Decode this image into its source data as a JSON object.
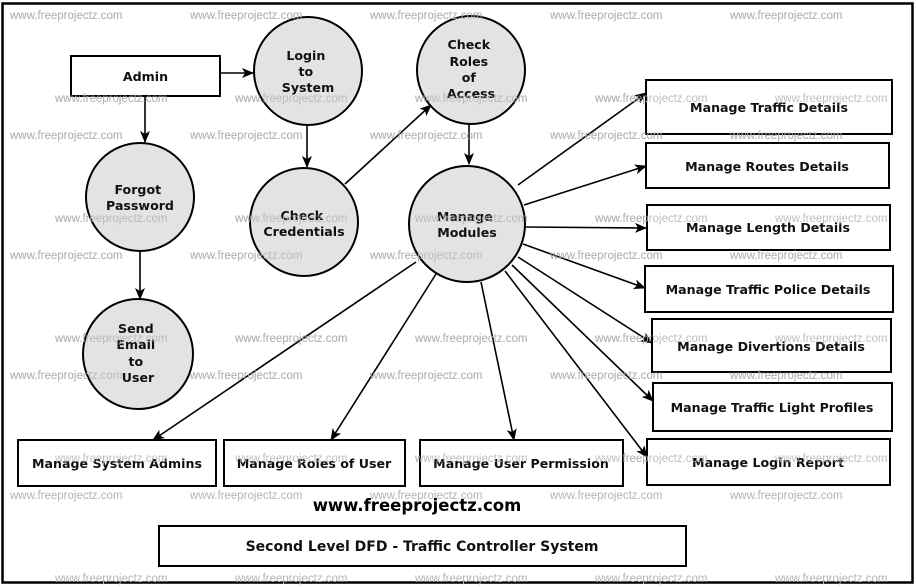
{
  "diagram": {
    "title": "Second Level DFD - Traffic Controller System",
    "website": "www.freeprojectz.com",
    "watermark_text": "www.freeprojectz.com",
    "colors": {
      "process_fill": "#e3e3e3",
      "stroke": "#000000",
      "watermark": "#b4b4b4",
      "background": "#ffffff"
    },
    "entities": [
      {
        "id": "admin",
        "label": "Admin"
      }
    ],
    "processes": [
      {
        "id": "login",
        "lines": [
          "Login",
          "to",
          "System"
        ]
      },
      {
        "id": "check_roles",
        "lines": [
          "Check",
          "Roles",
          "of",
          "Access"
        ]
      },
      {
        "id": "forgot",
        "lines": [
          "Forgot",
          "Password"
        ]
      },
      {
        "id": "check_cred",
        "lines": [
          "Check",
          "Credentials"
        ]
      },
      {
        "id": "manage_modules",
        "lines": [
          "Manage",
          "Modules"
        ]
      },
      {
        "id": "send_email",
        "lines": [
          "Send",
          "Email",
          "to",
          "User"
        ]
      }
    ],
    "modules": [
      {
        "id": "traffic",
        "label": "Manage Traffic Details"
      },
      {
        "id": "routes",
        "label": "Manage Routes Details"
      },
      {
        "id": "length",
        "label": "Manage Length Details"
      },
      {
        "id": "police",
        "label": "Manage Traffic Police Details"
      },
      {
        "id": "divertions",
        "label": "Manage Divertions Details"
      },
      {
        "id": "light",
        "label": "Manage Traffic Light Profiles"
      },
      {
        "id": "login_report",
        "label": "Manage Login Report"
      },
      {
        "id": "sys_admins",
        "label": "Manage System Admins"
      },
      {
        "id": "roles",
        "label": "Manage Roles of User"
      },
      {
        "id": "permission",
        "label": "Manage User Permission"
      }
    ],
    "flows": [
      {
        "from": "admin",
        "to": "login"
      },
      {
        "from": "admin",
        "to": "forgot"
      },
      {
        "from": "login",
        "to": "check_cred"
      },
      {
        "from": "check_cred",
        "to": "check_roles"
      },
      {
        "from": "check_roles",
        "to": "manage_modules"
      },
      {
        "from": "forgot",
        "to": "send_email"
      },
      {
        "from": "manage_modules",
        "to": "traffic"
      },
      {
        "from": "manage_modules",
        "to": "routes"
      },
      {
        "from": "manage_modules",
        "to": "length"
      },
      {
        "from": "manage_modules",
        "to": "police"
      },
      {
        "from": "manage_modules",
        "to": "divertions"
      },
      {
        "from": "manage_modules",
        "to": "light"
      },
      {
        "from": "manage_modules",
        "to": "login_report"
      },
      {
        "from": "manage_modules",
        "to": "sys_admins"
      },
      {
        "from": "manage_modules",
        "to": "roles"
      },
      {
        "from": "manage_modules",
        "to": "permission"
      }
    ]
  }
}
